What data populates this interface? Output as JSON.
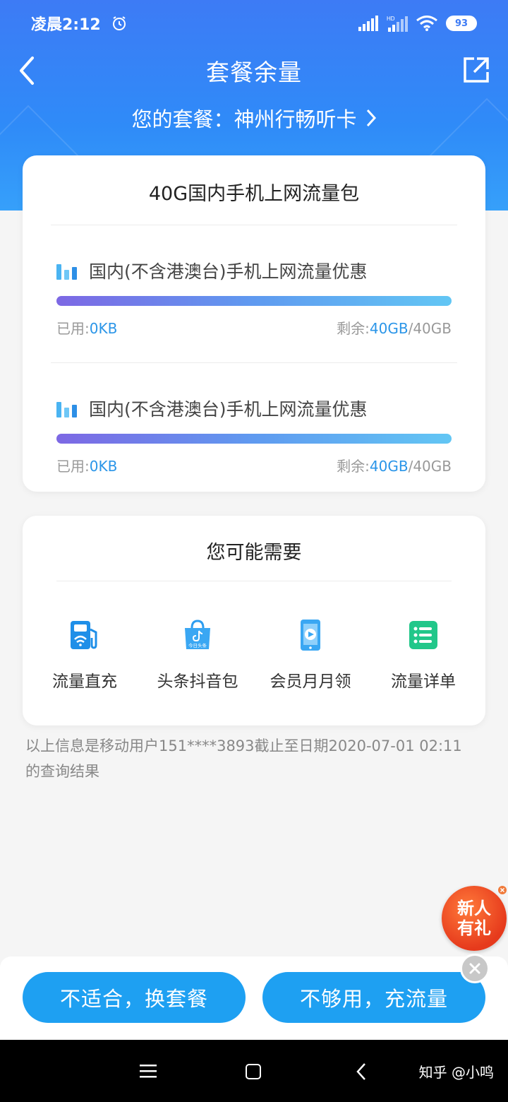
{
  "status_bar": {
    "time": "凌晨2:12",
    "battery": "93"
  },
  "nav": {
    "title": "套餐余量"
  },
  "plan": {
    "label": "您的套餐：神州行畅听卡"
  },
  "data_card": {
    "title": "40G国内手机上网流量包",
    "packages": [
      {
        "name": "国内(不含港澳台)手机上网流量优惠",
        "used_label": "已用:",
        "used_value": "0KB",
        "remain_label": "剩余:",
        "remain_value": "40GB",
        "total": "/40GB",
        "remaining_fraction": 1.0
      },
      {
        "name": "国内(不含港澳台)手机上网流量优惠",
        "used_label": "已用:",
        "used_value": "0KB",
        "remain_label": "剩余:",
        "remain_value": "40GB",
        "total": "/40GB",
        "remaining_fraction": 1.0
      }
    ]
  },
  "suggest_card": {
    "title": "您可能需要",
    "items": [
      {
        "label": "流量直充",
        "icon": "gas-pump-wifi-icon"
      },
      {
        "label": "头条抖音包",
        "icon": "shopping-bag-toutiao-icon"
      },
      {
        "label": "会员月月领",
        "icon": "phone-play-icon"
      },
      {
        "label": "流量详单",
        "icon": "list-icon"
      }
    ],
    "toutiao_badge": "今日头条"
  },
  "note": "以上信息是移动用户151****3893截止至日期2020-07-01 02:11的查询结果",
  "promo": {
    "line1": "新人",
    "line2": "有礼"
  },
  "actions": {
    "change_plan": "不适合，换套餐",
    "recharge": "不够用，充流量"
  },
  "watermark": "知乎 @小鸣",
  "colors": {
    "header_blue": "#3d7bf5",
    "accent_blue": "#2a95e8",
    "button_blue": "#1ea0f2"
  }
}
